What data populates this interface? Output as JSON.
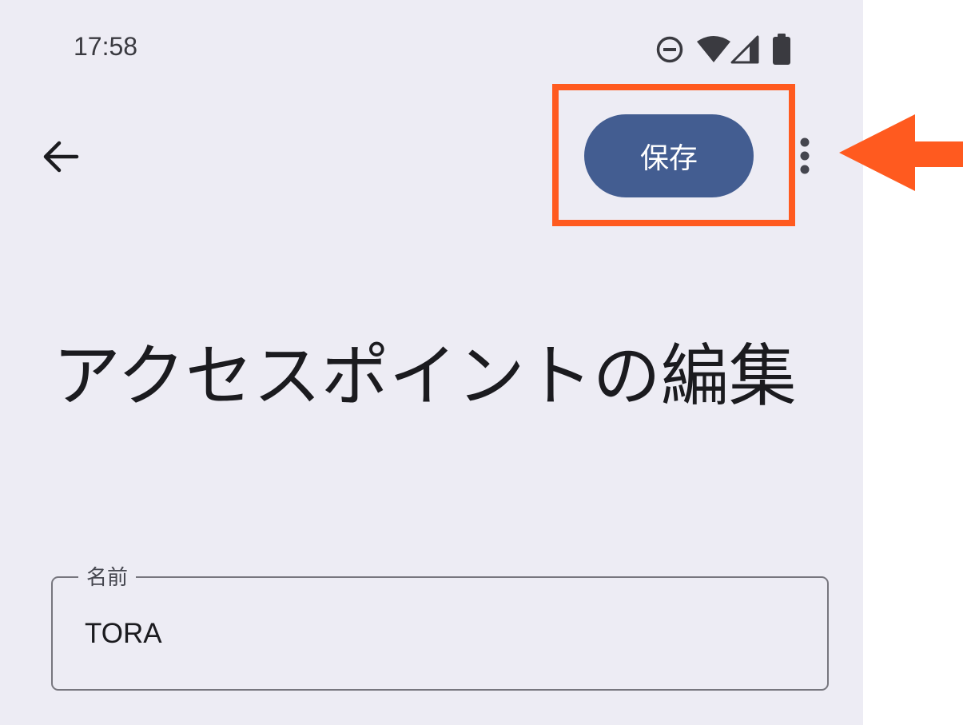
{
  "status_bar": {
    "time": "17:58",
    "icons": [
      "do-not-disturb-icon",
      "wifi-icon",
      "cell-signal-icon",
      "battery-icon"
    ]
  },
  "toolbar": {
    "back_icon": "arrow-back-icon",
    "save_label": "保存",
    "more_icon": "more-vert-icon"
  },
  "page": {
    "title": "アクセスポイントの編集"
  },
  "name_field": {
    "label": "名前",
    "value": "TORA"
  },
  "annotation": {
    "highlight_color": "#ff5a1f",
    "arrow_color": "#ff5a1f"
  },
  "colors": {
    "background": "#edecf4",
    "primary": "#435d91",
    "text": "#1b1b1f",
    "outline": "#77767e"
  }
}
